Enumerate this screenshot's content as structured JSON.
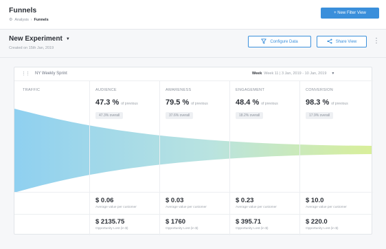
{
  "app": {
    "title": "Funnels",
    "breadcrumb": {
      "parent": "Analysis",
      "separator": "›",
      "current": "Funnels"
    },
    "new_filter_button": "+ New Filter View"
  },
  "experiment": {
    "title": "New Experiment",
    "created": "Created on 15th Jan, 2019",
    "configure_button": "Configure Data",
    "share_button": "Share View"
  },
  "card": {
    "sprint_name": "NY Weekly Sprint",
    "week_label": "Week",
    "week_range": "Week 11 | 3 Jan, 2019 - 10 Jan, 2019",
    "traffic_label": "TRAFFIC",
    "stages": [
      {
        "label": "AUDIENCE",
        "percent": "47.3 %",
        "percent_note": "of previous",
        "overall": "47.3% overall",
        "avg_value": "$ 0.06",
        "avg_caption": "Average value per customer",
        "opp_value": "$ 2135.75",
        "opp_caption": "Opportunity Lost (in $)"
      },
      {
        "label": "AWARENESS",
        "percent": "79.5 %",
        "percent_note": "of previous",
        "overall": "37.6% overall",
        "avg_value": "$ 0.03",
        "avg_caption": "Average value per customer",
        "opp_value": "$ 1760",
        "opp_caption": "Opportunity Lost (in $)"
      },
      {
        "label": "ENGAGEMENT",
        "percent": "48.4 %",
        "percent_note": "of previous",
        "overall": "18.2% overall",
        "avg_value": "$ 0.23",
        "avg_caption": "Average value per customer",
        "opp_value": "$ 395.71",
        "opp_caption": "Opportunity Lost (in $)"
      },
      {
        "label": "CONVERSION",
        "percent": "98.3 %",
        "percent_note": "of previous",
        "overall": "17.9% overall",
        "avg_value": "$ 10.0",
        "avg_caption": "Average value per customer",
        "opp_value": "$ 220.0",
        "opp_caption": "Opportunity Lost (in $)"
      }
    ]
  },
  "colors": {
    "primary": "#3a8fdb",
    "funnel_start": "#8fd0f0",
    "funnel_end": "#d9ef9a"
  },
  "icons": {
    "breadcrumb": "analysis-icon",
    "configure": "filter-icon",
    "share": "share-icon",
    "more": "kebab-menu-icon",
    "drag": "drag-handle-icon"
  }
}
